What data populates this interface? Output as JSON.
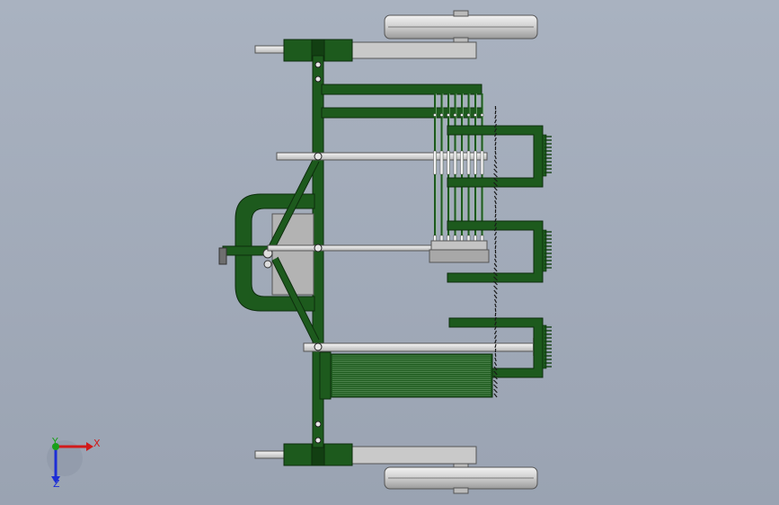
{
  "triad": {
    "x_label": "X",
    "y_label": "Y",
    "z_label": "Z",
    "x_color": "#d11a1a",
    "y_color": "#19a019",
    "z_color": "#1d2ed6"
  },
  "colors": {
    "frame_green": "#1d5a1d",
    "frame_dark": "#123f12",
    "metal": "#d8d8d8",
    "metal_dark": "#8c8c8c",
    "background": "#a9b2c0"
  }
}
